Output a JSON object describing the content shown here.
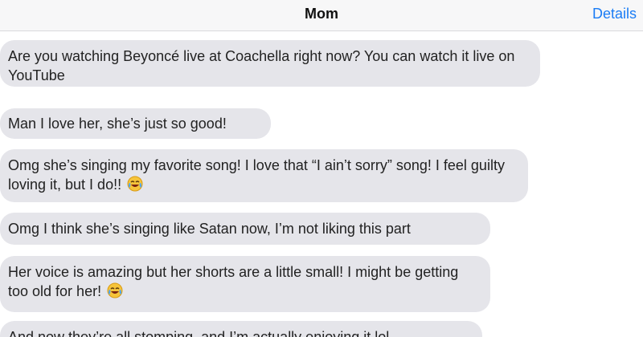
{
  "header": {
    "title": "Mom",
    "details_label": "Details"
  },
  "messages": [
    {
      "text": "Are you watching Beyoncé live at Coachella right now? You can watch it live on YouTube"
    },
    {
      "text": "Man I love her, she’s just so good!"
    },
    {
      "text": "Omg she’s singing my favorite song! I love that “I ain’t sorry” song! I feel guilty loving it, but I do!!",
      "emoji": "face-with-tears-of-joy-icon"
    },
    {
      "text": "Omg I think she’s singing like Satan now, I’m not liking this part"
    },
    {
      "text": "Her voice is amazing but her shorts are a little small! I might be getting too old for her!",
      "emoji": "face-with-tears-of-joy-icon"
    },
    {
      "text": "And now they’re all stomping, and I’m actually enjoying it lol"
    }
  ],
  "colors": {
    "accent": "#1a7cf5",
    "incoming_bubble": "#e5e5ea",
    "navbar_bg": "#f7f7f8"
  }
}
